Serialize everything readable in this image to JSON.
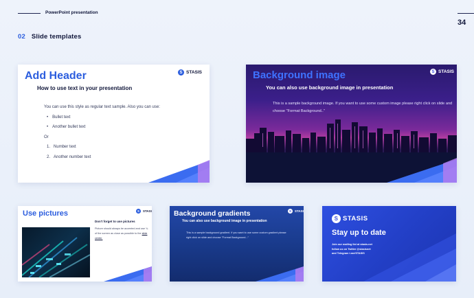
{
  "header": {
    "title": "PowerPoint presentation",
    "page_number": "34"
  },
  "section": {
    "number": "02",
    "title": "Slide templates"
  },
  "brand": {
    "name": "STASIS",
    "accent": "#2b5dde"
  },
  "slides": {
    "add_header": {
      "title": "Add Header",
      "subtitle": "How to use text in your presentation",
      "intro": "You can use this style as regular text sample. Also you can use:",
      "bullets": [
        "Bullet text",
        "Another bullet text"
      ],
      "or": "Or",
      "numbered": [
        {
          "num": "1.",
          "text": "Number text"
        },
        {
          "num": "2.",
          "text": "Another number text"
        }
      ]
    },
    "background_image": {
      "title": "Background image",
      "subtitle": "You can also use background image in presentation",
      "body": "This is a sample background image. If you want to use some custom image please right click on slide and choose \"Format Background..\""
    },
    "use_pictures": {
      "title": "Use pictures",
      "heading": "Don't forget to use pictures",
      "body": "Picture should always be accented and use ¾ of the screen as close as possible to the",
      "link": "slide center."
    },
    "background_gradients": {
      "title": "Background gradients",
      "subtitle": "You can also use background image in presentation",
      "body": "This is a sample background gradient. If you want to use some custom gradient please right click on slide and choose \"Format Background...\""
    },
    "stay_up_to_date": {
      "title": "Stay up to date",
      "lines": [
        "Join our mailing list at stasis.net",
        "follow us on Twitter @stasisnet",
        "and Telegram t.me/STASIS"
      ]
    }
  }
}
